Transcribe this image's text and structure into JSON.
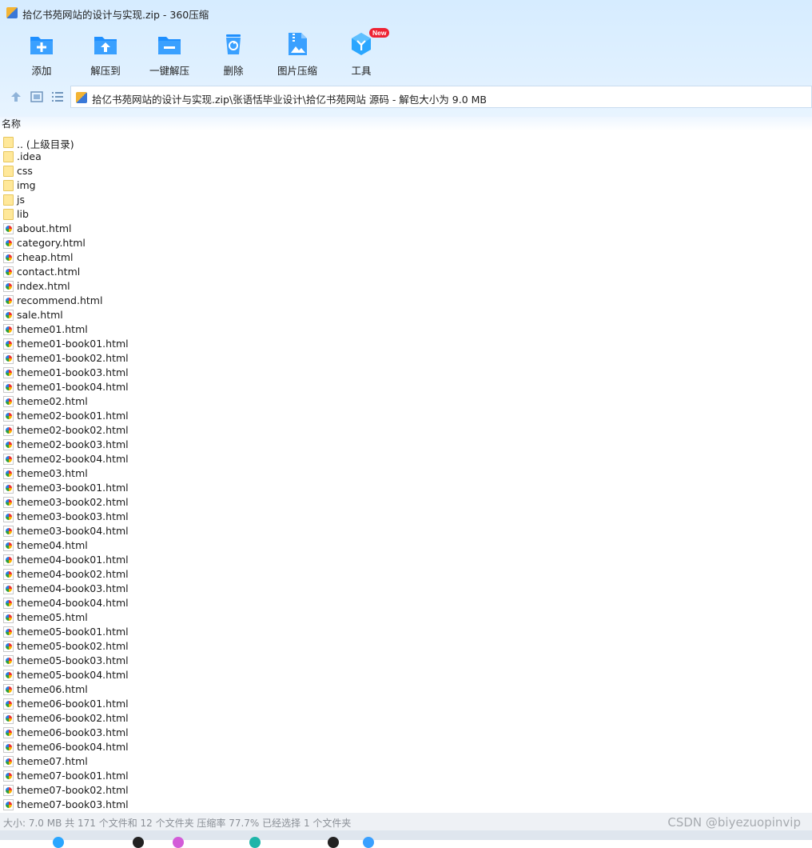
{
  "window": {
    "title": "拾亿书苑网站的设计与实现.zip - 360压缩"
  },
  "toolbar": {
    "buttons": [
      {
        "label": "添加",
        "icon": "add-icon"
      },
      {
        "label": "解压到",
        "icon": "extract-to-icon"
      },
      {
        "label": "一键解压",
        "icon": "one-click-extract-icon"
      },
      {
        "label": "删除",
        "icon": "delete-icon"
      },
      {
        "label": "图片压缩",
        "icon": "image-compress-icon"
      },
      {
        "label": "工具",
        "icon": "tools-icon",
        "badge": "New"
      }
    ]
  },
  "nav": {
    "path": "拾亿书苑网站的设计与实现.zip\\张语恬毕业设计\\拾亿书苑网站 源码 - 解包大小为 9.0 MB"
  },
  "list": {
    "column_name": "名称",
    "items": [
      {
        "name": ".. (上级目录)",
        "type": "folder"
      },
      {
        "name": ".idea",
        "type": "folder"
      },
      {
        "name": "css",
        "type": "folder"
      },
      {
        "name": "img",
        "type": "folder"
      },
      {
        "name": "js",
        "type": "folder"
      },
      {
        "name": "lib",
        "type": "folder"
      },
      {
        "name": "about.html",
        "type": "html"
      },
      {
        "name": "category.html",
        "type": "html"
      },
      {
        "name": "cheap.html",
        "type": "html"
      },
      {
        "name": "contact.html",
        "type": "html"
      },
      {
        "name": "index.html",
        "type": "html"
      },
      {
        "name": "recommend.html",
        "type": "html"
      },
      {
        "name": "sale.html",
        "type": "html"
      },
      {
        "name": "theme01.html",
        "type": "html"
      },
      {
        "name": "theme01-book01.html",
        "type": "html"
      },
      {
        "name": "theme01-book02.html",
        "type": "html"
      },
      {
        "name": "theme01-book03.html",
        "type": "html"
      },
      {
        "name": "theme01-book04.html",
        "type": "html"
      },
      {
        "name": "theme02.html",
        "type": "html"
      },
      {
        "name": "theme02-book01.html",
        "type": "html"
      },
      {
        "name": "theme02-book02.html",
        "type": "html"
      },
      {
        "name": "theme02-book03.html",
        "type": "html"
      },
      {
        "name": "theme02-book04.html",
        "type": "html"
      },
      {
        "name": "theme03.html",
        "type": "html"
      },
      {
        "name": "theme03-book01.html",
        "type": "html"
      },
      {
        "name": "theme03-book02.html",
        "type": "html"
      },
      {
        "name": "theme03-book03.html",
        "type": "html"
      },
      {
        "name": "theme03-book04.html",
        "type": "html"
      },
      {
        "name": "theme04.html",
        "type": "html"
      },
      {
        "name": "theme04-book01.html",
        "type": "html"
      },
      {
        "name": "theme04-book02.html",
        "type": "html"
      },
      {
        "name": "theme04-book03.html",
        "type": "html"
      },
      {
        "name": "theme04-book04.html",
        "type": "html"
      },
      {
        "name": "theme05.html",
        "type": "html"
      },
      {
        "name": "theme05-book01.html",
        "type": "html"
      },
      {
        "name": "theme05-book02.html",
        "type": "html"
      },
      {
        "name": "theme05-book03.html",
        "type": "html"
      },
      {
        "name": "theme05-book04.html",
        "type": "html"
      },
      {
        "name": "theme06.html",
        "type": "html"
      },
      {
        "name": "theme06-book01.html",
        "type": "html"
      },
      {
        "name": "theme06-book02.html",
        "type": "html"
      },
      {
        "name": "theme06-book03.html",
        "type": "html"
      },
      {
        "name": "theme06-book04.html",
        "type": "html"
      },
      {
        "name": "theme07.html",
        "type": "html"
      },
      {
        "name": "theme07-book01.html",
        "type": "html"
      },
      {
        "name": "theme07-book02.html",
        "type": "html"
      },
      {
        "name": "theme07-book03.html",
        "type": "html"
      }
    ]
  },
  "status": {
    "text": "大小: 7.0 MB 共 171 个文件和 12 个文件夹 压缩率 77.7% 已经选择 1 个文件夹",
    "watermark": "CSDN @biyezuopinvip"
  },
  "colors": {
    "accent": "#1e8fff",
    "chrome_bg": "#dcefff",
    "folder": "#ffe89a"
  }
}
